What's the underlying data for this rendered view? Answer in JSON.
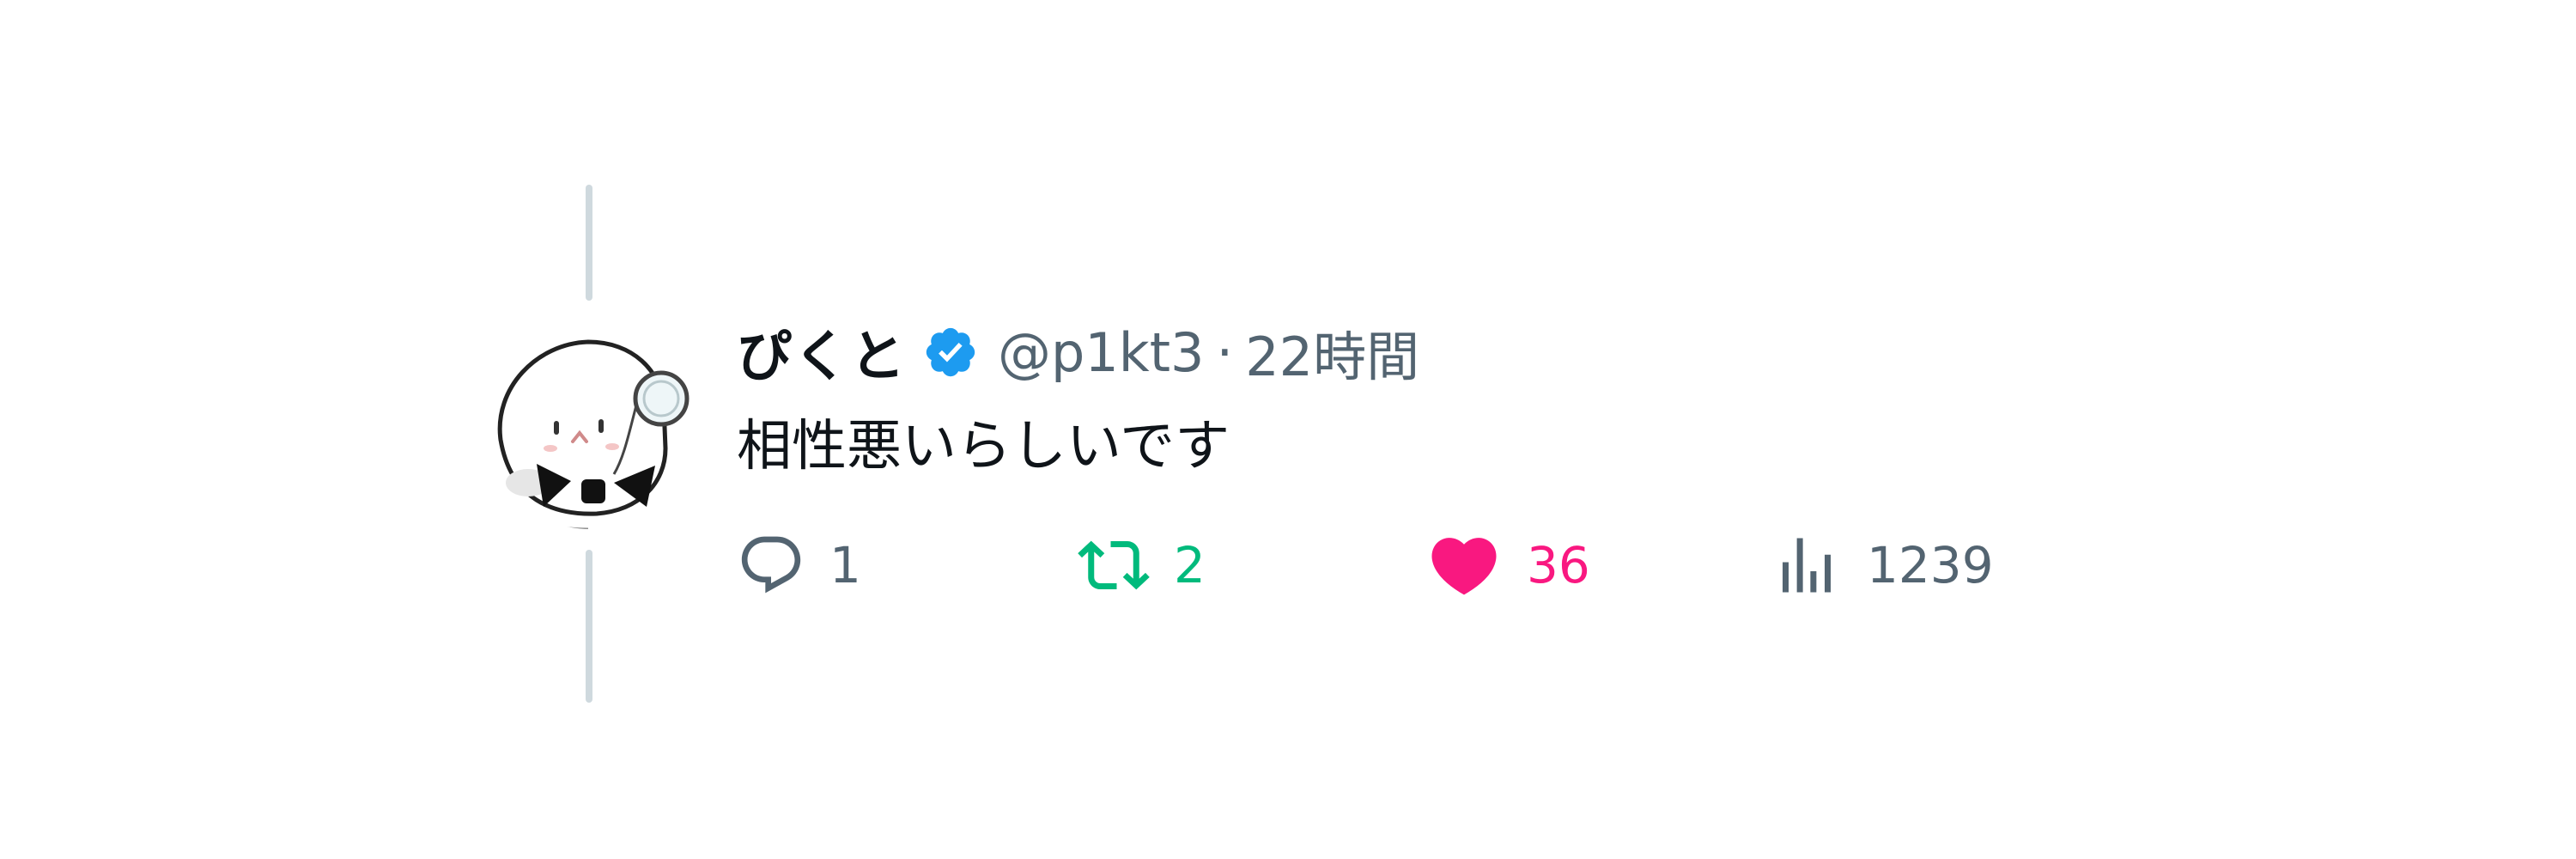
{
  "tweet": {
    "display_name": "ぴくと",
    "handle": "@p1kt3",
    "separator": "·",
    "timestamp": "22時間",
    "text": "相性悪いらしいです",
    "verified": true
  },
  "actions": {
    "replies": "1",
    "retweets": "2",
    "likes": "36",
    "views": "1239"
  },
  "colors": {
    "verified_badge": "#1d9bf0",
    "retweet_green": "#00ba7c",
    "like_pink": "#f91880",
    "muted_gray": "#536471",
    "thread_line": "#cfd9de"
  },
  "icons": {
    "reply": "reply-bubble-icon",
    "retweet": "retweet-icon",
    "like": "heart-icon",
    "views": "bar-chart-icon",
    "verified": "verified-badge-icon"
  }
}
